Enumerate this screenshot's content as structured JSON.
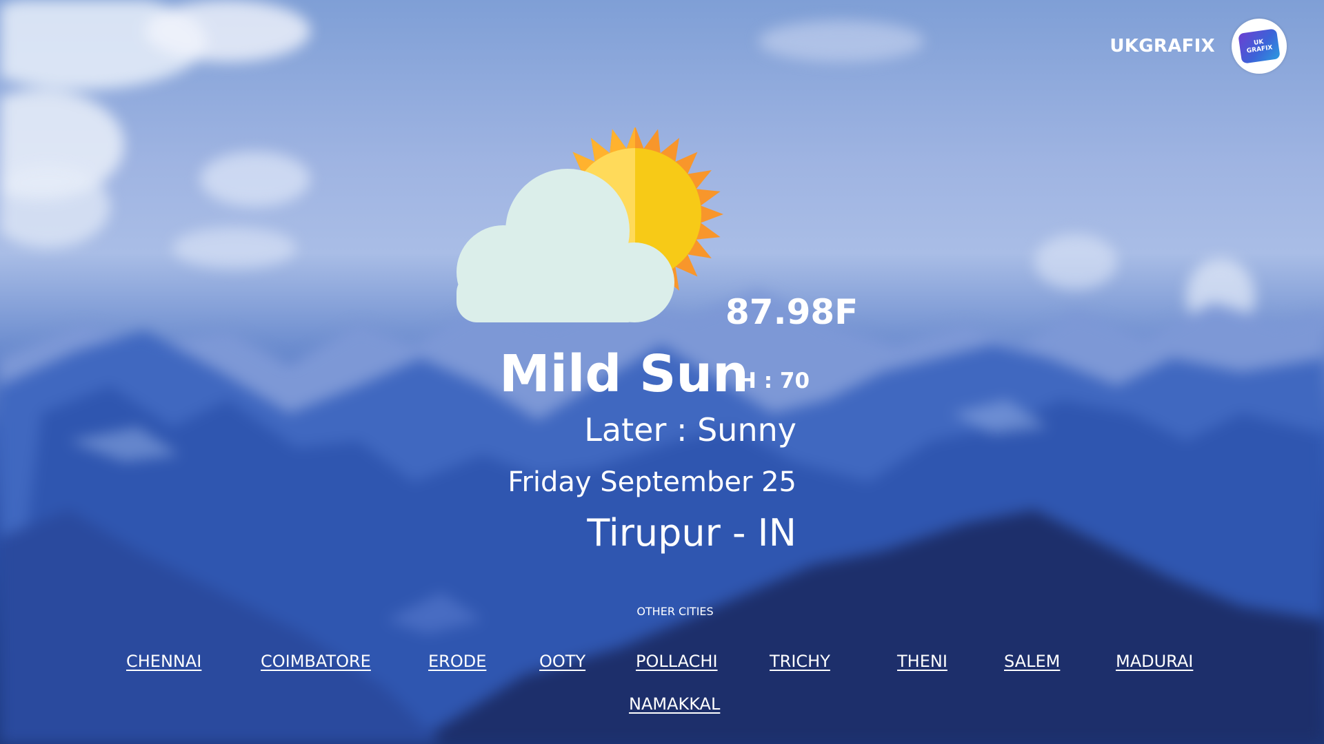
{
  "brand": {
    "name": "UKGRAFIX",
    "logo_text_line1": "UK",
    "logo_text_line2": "GRAFIX"
  },
  "weather": {
    "icon": "partly-sunny-icon",
    "temperature": "87.98F",
    "condition": "Mild Sun",
    "humidity": "H : 70",
    "later": "Later : Sunny",
    "date": "Friday September 25",
    "location": "Tirupur - IN"
  },
  "other_cities": {
    "title": "OTHER CITIES",
    "cities": [
      "CHENNAI",
      "COIMBATORE",
      "ERODE",
      "OOTY",
      "POLLACHI",
      "TRICHY",
      "THENI",
      "SALEM",
      "MADURAI",
      "NAMAKKAL"
    ]
  },
  "colors": {
    "sun_outer": "#F8962B",
    "sun_inner_light": "#FFDA5A",
    "sun_inner": "#F7CA17",
    "cloud": "#DBEEEA",
    "text": "#FFFFFF"
  }
}
